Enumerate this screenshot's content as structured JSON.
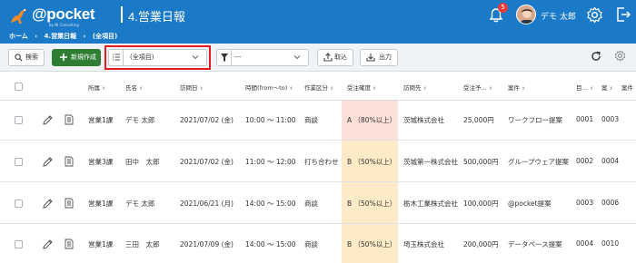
{
  "header": {
    "logo_text": "@pocket",
    "logo_sub": "by NI Consulting",
    "page_title": "4.営業日報",
    "notification_count": "5",
    "user_name": "デモ 太郎"
  },
  "breadcrumb": [
    "ホーム",
    "›",
    "4.営業日報",
    "›",
    "(全項目)"
  ],
  "toolbar": {
    "search_label": "検索",
    "new_label": "新規作成",
    "view_select": "(全項目)",
    "filter_select": "---",
    "import_label": "取込",
    "export_label": "出力"
  },
  "columns": [
    "所属",
    "氏名",
    "訪問日",
    "時間(from～to)",
    "作業区分",
    "受注確度",
    "訪問先",
    "受注予…",
    "案件",
    "目…",
    "案",
    "案件"
  ],
  "rows": [
    {
      "dept": "営業1課",
      "name": "デモ 太郎",
      "date": "2021/07/02 (金)",
      "time": "10:00 ～ 11:00",
      "type": "商談",
      "accuracy": "A （80%以上）",
      "accuracy_level": "A",
      "customer": "茨城株式会社",
      "amount": "25,000円",
      "project": "ワークフロー提案",
      "c1": "0001",
      "c2": "0003"
    },
    {
      "dept": "営業3課",
      "name": "田中　太郎",
      "date": "2021/07/02 (金)",
      "time": "11:00 ～ 12:00",
      "type": "打ち合わせ",
      "accuracy": "B （50%以上）",
      "accuracy_level": "B",
      "customer": "茨城第一株式会社",
      "amount": "500,000円",
      "project": "グループウェア提案",
      "c1": "0002",
      "c2": "0004"
    },
    {
      "dept": "営業1課",
      "name": "デモ 太郎",
      "date": "2021/06/21 (月)",
      "time": "14:00 ～ 15:00",
      "type": "商談",
      "accuracy": "B （50%以上）",
      "accuracy_level": "B",
      "customer": "栃木工業株式会社",
      "amount": "100,000円",
      "project": "@pocket提案",
      "c1": "0003",
      "c2": "0006"
    },
    {
      "dept": "営業1課",
      "name": "三田　太郎",
      "date": "2021/07/09 (金)",
      "time": "14:00 ～ 15:00",
      "type": "商談",
      "accuracy": "B （50%以上）",
      "accuracy_level": "B",
      "customer": "埼玉株式会社",
      "amount": "200,000円",
      "project": "データベース提案",
      "c1": "0004",
      "c2": "0010"
    }
  ],
  "colors": {
    "header_blue": "#1a7ac8",
    "accent_red": "#e31c23",
    "new_button_green": "#2e7d32",
    "accuracy_a": "#fbe0d8",
    "accuracy_b": "#fdeac6"
  }
}
